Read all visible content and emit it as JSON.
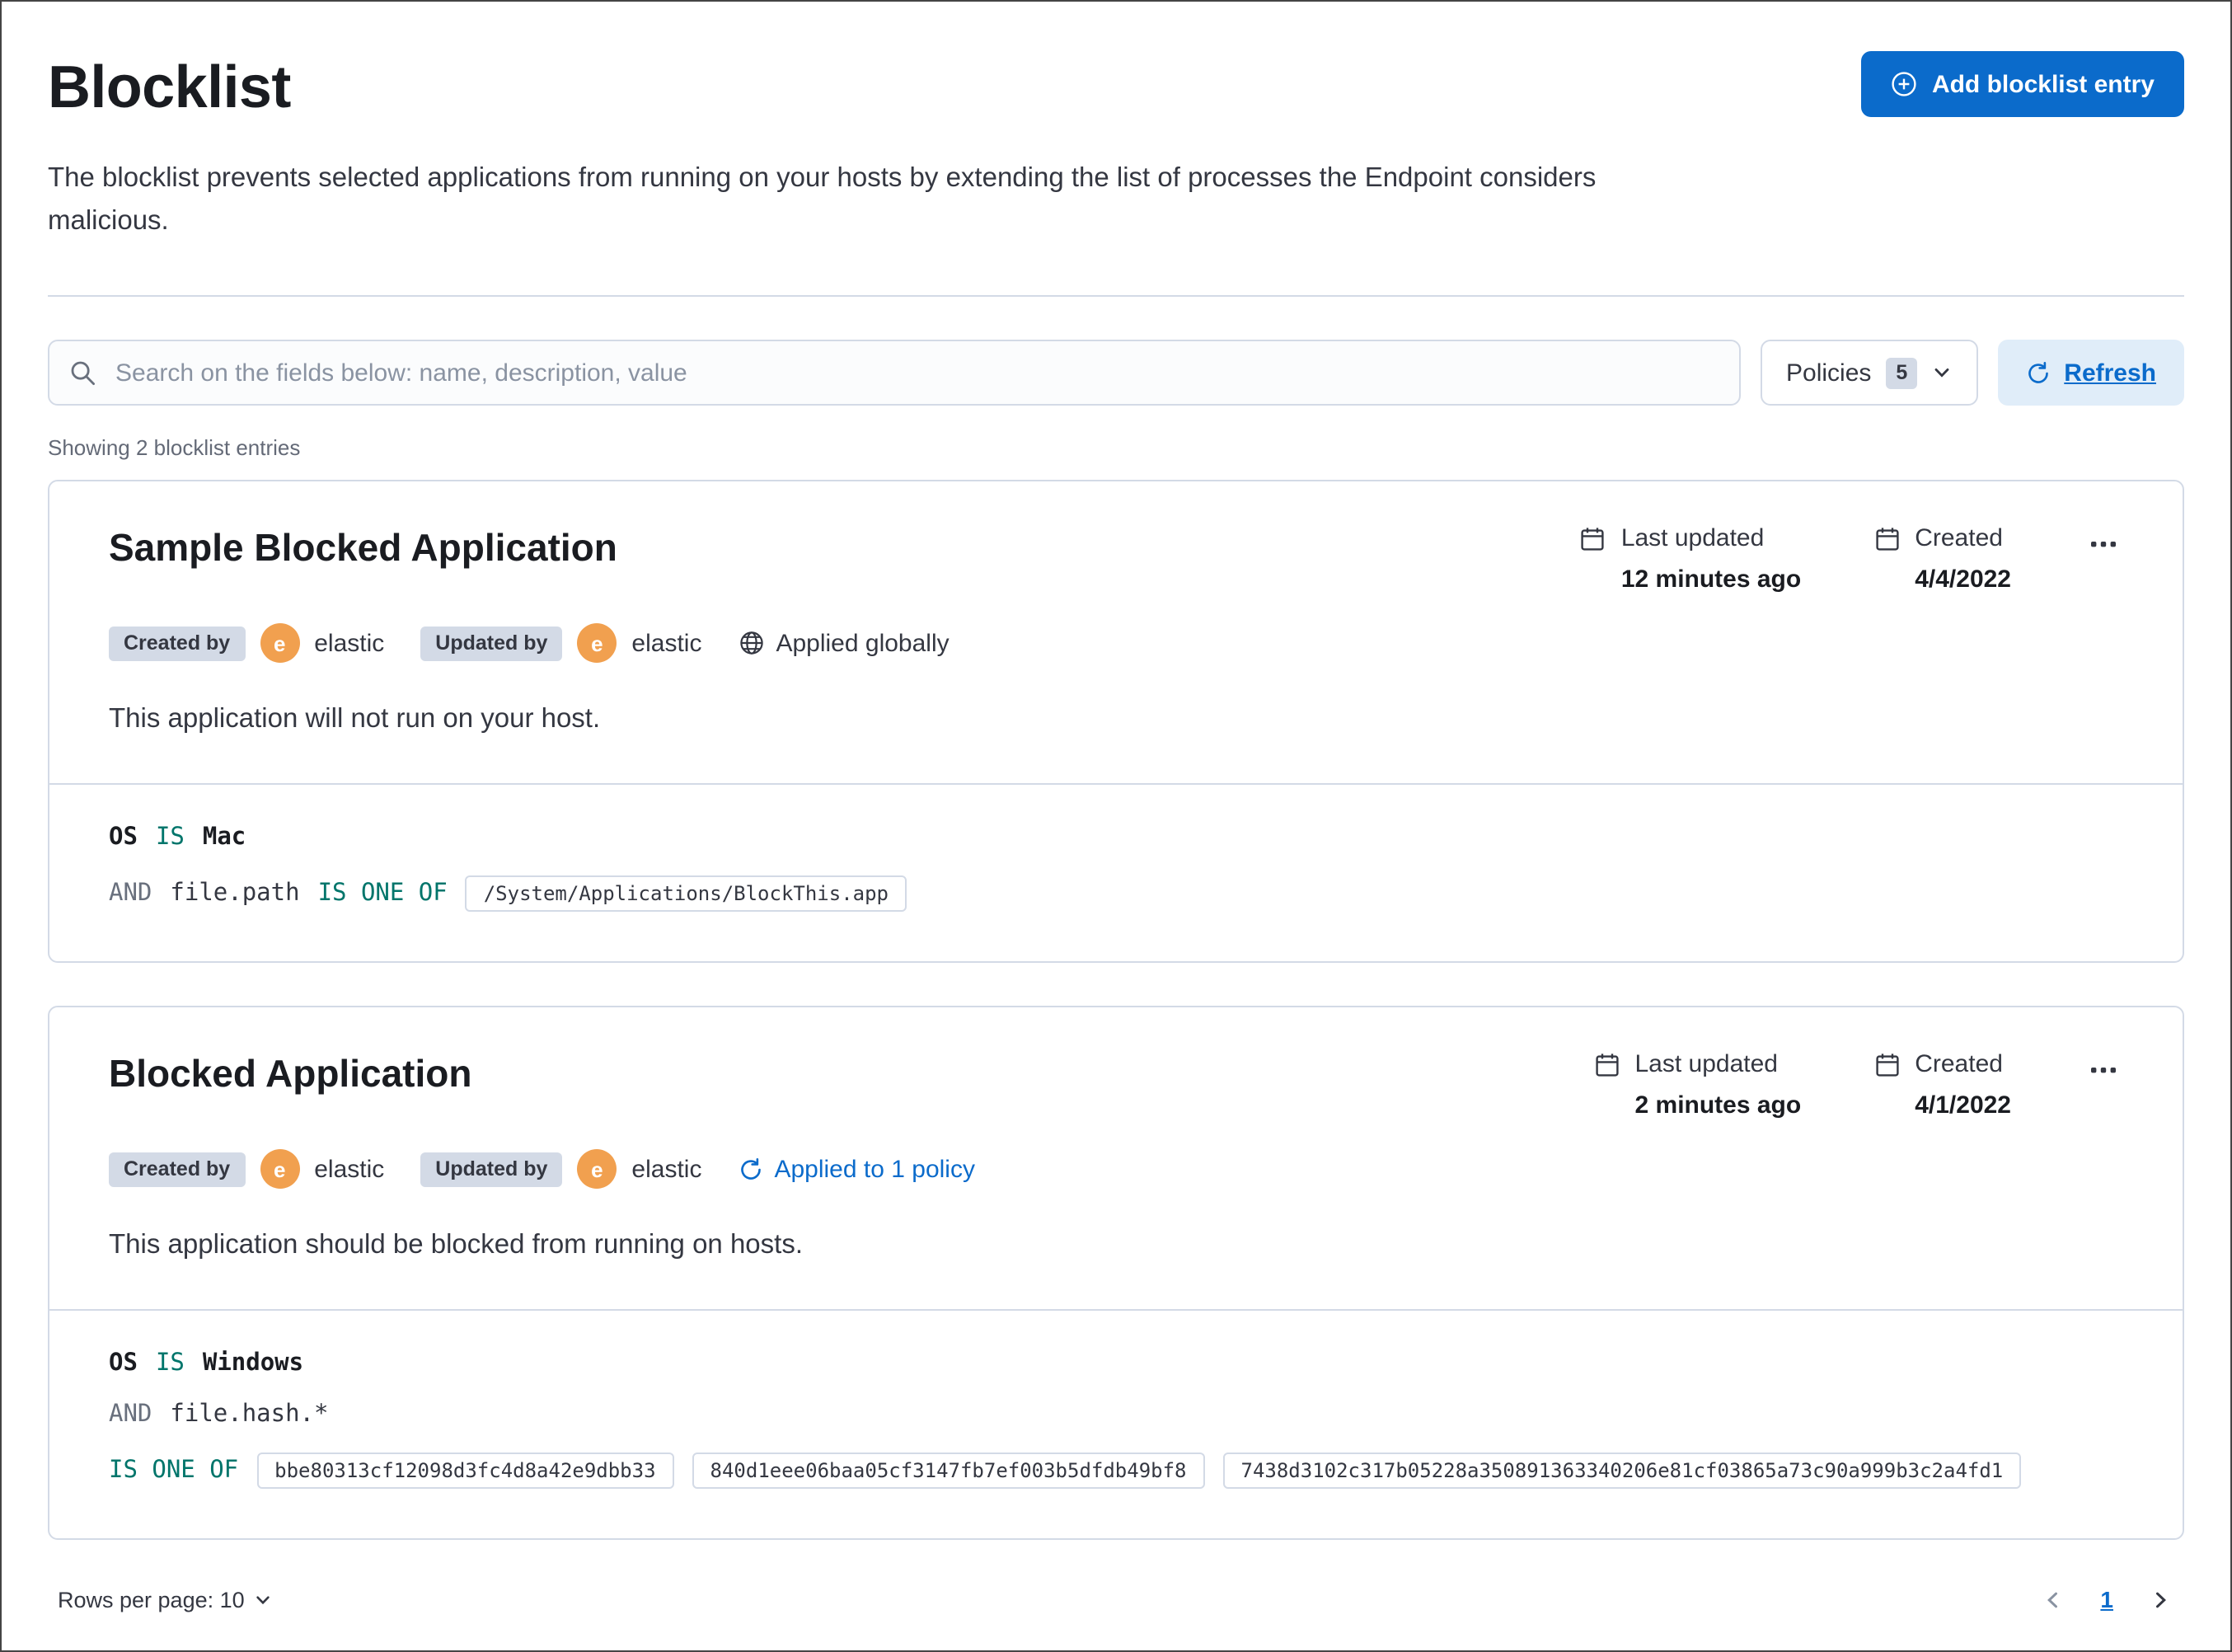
{
  "header": {
    "title": "Blocklist",
    "description": "The blocklist prevents selected applications from running on your hosts by extending the list of processes the Endpoint considers malicious.",
    "add_button_label": "Add blocklist entry"
  },
  "toolbar": {
    "search_placeholder": "Search on the fields below: name, description, value",
    "policies_label": "Policies",
    "policies_count": "5",
    "refresh_label": "Refresh"
  },
  "list": {
    "showing_text": "Showing 2 blocklist entries"
  },
  "entries": [
    {
      "name": "Sample Blocked Application",
      "created_by_label": "Created by",
      "created_by_user": "elastic",
      "updated_by_label": "Updated by",
      "updated_by_user": "elastic",
      "avatar_initial": "e",
      "applied_label": "Applied globally",
      "last_updated_label": "Last updated",
      "last_updated_value": "12 minutes ago",
      "created_label": "Created",
      "created_value": "4/4/2022",
      "description": "This application will not run on your host.",
      "criteria": {
        "os_field": "OS",
        "os_operator": "IS",
        "os_value": "Mac",
        "conjunction": "AND",
        "field": "file.path",
        "operator": "IS ONE OF",
        "values": [
          "/System/Applications/BlockThis.app"
        ]
      }
    },
    {
      "name": "Blocked Application",
      "created_by_label": "Created by",
      "created_by_user": "elastic",
      "updated_by_label": "Updated by",
      "updated_by_user": "elastic",
      "avatar_initial": "e",
      "applied_label": "Applied to 1 policy",
      "last_updated_label": "Last updated",
      "last_updated_value": "2 minutes ago",
      "created_label": "Created",
      "created_value": "4/1/2022",
      "description": "This application should be blocked from running on hosts.",
      "criteria": {
        "os_field": "OS",
        "os_operator": "IS",
        "os_value": "Windows",
        "conjunction": "AND",
        "field": "file.hash.*",
        "operator": "IS ONE OF",
        "values": [
          "bbe80313cf12098d3fc4d8a42e9dbb33",
          "840d1eee06baa05cf3147fb7ef003b5dfdb49bf8",
          "7438d3102c317b05228a350891363340206e81cf03865a73c90a999b3c2a4fd1"
        ]
      }
    }
  ],
  "footer": {
    "rows_per_page_label": "Rows per page: 10",
    "current_page": "1"
  },
  "colors": {
    "primary": "#0b6bcb",
    "operator_teal": "#00756b",
    "avatar_orange": "#f1a04f"
  },
  "icons": [
    "plus-in-circle",
    "search",
    "chevron-down",
    "refresh",
    "calendar",
    "boxes-horizontal",
    "globe",
    "policy-sync",
    "chevron-left",
    "chevron-right"
  ]
}
